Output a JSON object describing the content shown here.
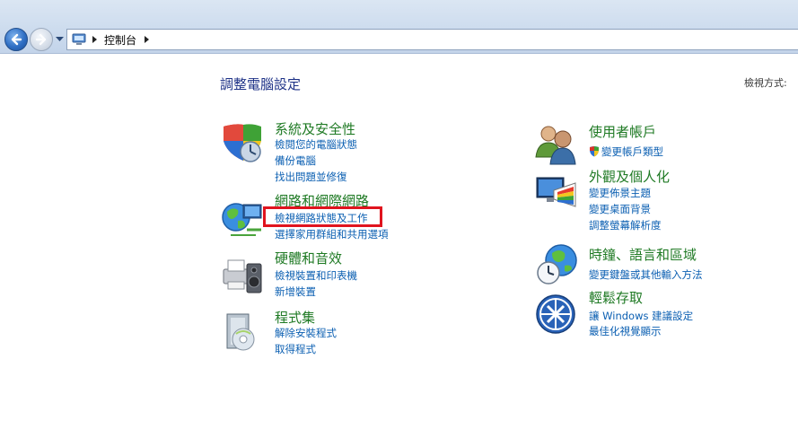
{
  "breadcrumb": {
    "items": [
      "控制台"
    ]
  },
  "page": {
    "title": "調整電腦設定",
    "view_by_label": "檢視方式:"
  },
  "categories": {
    "system_security": {
      "title": "系統及安全性",
      "links": [
        "檢閱您的電腦狀態",
        "備份電腦",
        "找出問題並修復"
      ]
    },
    "network_internet": {
      "title": "網路和網際網路",
      "links": [
        "檢視網路狀態及工作",
        "選擇家用群組和共用選項"
      ]
    },
    "hardware_sound": {
      "title": "硬體和音效",
      "links": [
        "檢視裝置和印表機",
        "新增裝置"
      ]
    },
    "programs": {
      "title": "程式集",
      "links": [
        "解除安裝程式",
        "取得程式"
      ]
    },
    "user_accounts": {
      "title": "使用者帳戶",
      "links": [
        "變更帳戶類型"
      ]
    },
    "appearance": {
      "title": "外觀及個人化",
      "links": [
        "變更佈景主題",
        "變更桌面背景",
        "調整螢幕解析度"
      ]
    },
    "clock_region": {
      "title": "時鐘、語言和區域",
      "links": [
        "變更鍵盤或其他輸入方法"
      ]
    },
    "ease_of_access": {
      "title": "輕鬆存取",
      "links": [
        "讓 Windows 建議設定",
        "最佳化視覺顯示"
      ]
    }
  },
  "colors": {
    "category_title": "#1f7a24",
    "link": "#0b5fb2",
    "page_title": "#1e3287",
    "highlight": "#e0141e"
  }
}
